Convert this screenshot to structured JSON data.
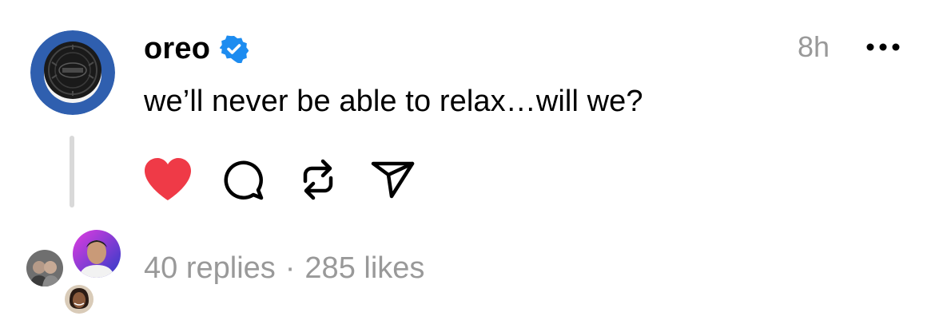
{
  "post": {
    "username": "oreo",
    "timestamp": "8h",
    "text": "we’ll never be able to relax…will we?",
    "liked": true
  },
  "stats": {
    "replies": "40 replies",
    "separator": "·",
    "likes": "285 likes"
  },
  "colors": {
    "like": "#ef3a47",
    "verified": "#1d8cf0",
    "avatar_bg": "#2f5faf",
    "muted_text": "#999999"
  },
  "icons": [
    "verified-badge-icon",
    "more-icon",
    "heart-icon",
    "comment-icon",
    "repost-icon",
    "share-icon"
  ]
}
